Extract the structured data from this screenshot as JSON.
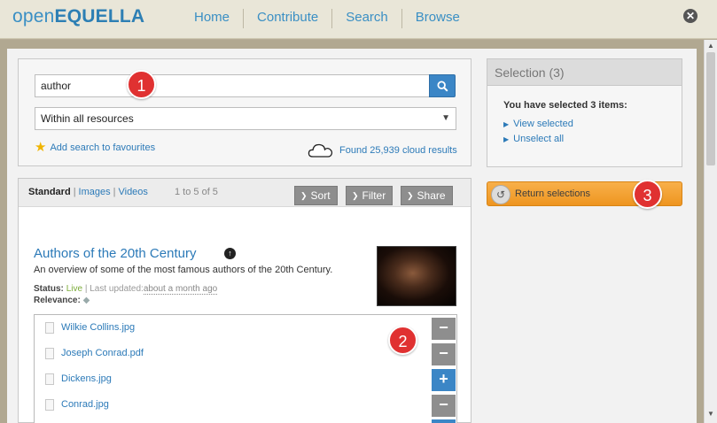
{
  "header": {
    "logo_light": "open",
    "logo_bold": "EQUELLA",
    "nav": [
      "Home",
      "Contribute",
      "Search",
      "Browse"
    ],
    "close_glyph": "✕"
  },
  "search": {
    "query": "author",
    "scope": "Within all resources",
    "favourites_label": "Add search to favourites",
    "cloud_label": "Found 25,939 cloud results"
  },
  "results": {
    "modes": {
      "current": "Standard",
      "images": "Images",
      "videos": "Videos"
    },
    "paging": "1 to 5 of 5",
    "toolbar": {
      "sort": "Sort",
      "filter": "Filter",
      "share": "Share"
    },
    "item": {
      "title": "Authors of the 20th Century",
      "description": "An overview of some of the most famous authors of the 20th Century.",
      "status_label": "Status:",
      "status_value": "Live",
      "updated_label": "| Last updated:",
      "updated_value": "about a month ago",
      "relevance_label": "Relevance:"
    },
    "attachments": [
      {
        "name": "Wilkie Collins.jpg",
        "action": "−",
        "state": "selected"
      },
      {
        "name": "Joseph Conrad.pdf",
        "action": "−",
        "state": "selected"
      },
      {
        "name": "Dickens.jpg",
        "action": "+",
        "state": "unselected"
      },
      {
        "name": "Conrad.jpg",
        "action": "−",
        "state": "selected"
      }
    ]
  },
  "selection": {
    "title": "Selection (3)",
    "summary": "You have selected 3 items:",
    "view_label": "View selected",
    "unselect_label": "Unselect all",
    "return_label": "Return selections"
  },
  "callouts": [
    "1",
    "2",
    "3"
  ],
  "colors": {
    "accent": "#3b86c6",
    "link": "#2c7ab8",
    "return": "#ee9520",
    "badge": "#e03131"
  }
}
